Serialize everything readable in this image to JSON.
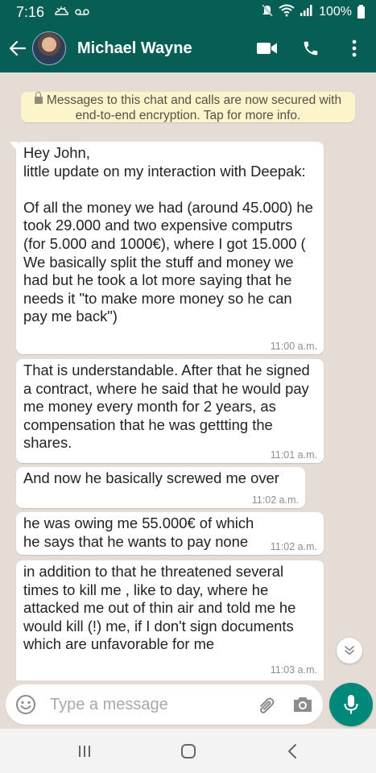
{
  "status_bar": {
    "time": "7:16",
    "battery": "100%",
    "icons": [
      "weather-icon",
      "voicemail-icon",
      "mute-icon",
      "wifi-icon",
      "signal-icon",
      "battery-icon"
    ]
  },
  "header": {
    "contact_name": "Michael Wayne",
    "icons": [
      "back-arrow-icon",
      "video-call-icon",
      "phone-icon",
      "more-vertical-icon"
    ]
  },
  "notice": {
    "text": "Messages to this chat and calls are now secured with end-to-end encryption. Tap for more info."
  },
  "messages": [
    {
      "text": "Hey John,\nlittle update on my interaction with Deepak:\n\nOf all the money we had (around 45.000) he took 29.000 and two expensive computrs (for 5.000 and 1000€), where I got 15.000 ( We basically split the stuff and money we had but he took a lot more saying that he needs it \"to make more money so he can pay me back\")",
      "time": "11:00 a.m."
    },
    {
      "text": "That is understandable. After that he signed a contract, where he said that he would pay me money every month for 2 years, as compensation that he was gettting the shares.",
      "time": "11:01 a.m."
    },
    {
      "text": "And now he basically screwed me over",
      "time": "11:02 a.m."
    },
    {
      "text": "he was owing me 55.000€ of which he says that he wants to pay none",
      "time": "11:02 a.m."
    },
    {
      "text": "in addition to that he threatened several times to kill me , like to day, where he attacked me out of thin air and told me he would kill (!) me, if I don't sign documents which are unfavorable for me",
      "time": "11:03 a.m."
    }
  ],
  "composer": {
    "placeholder": "Type a message"
  },
  "colors": {
    "header": "#075e54",
    "chat_background": "#e5ddd5",
    "notice_background": "#fcf4cb",
    "mic_button": "#00897b"
  }
}
